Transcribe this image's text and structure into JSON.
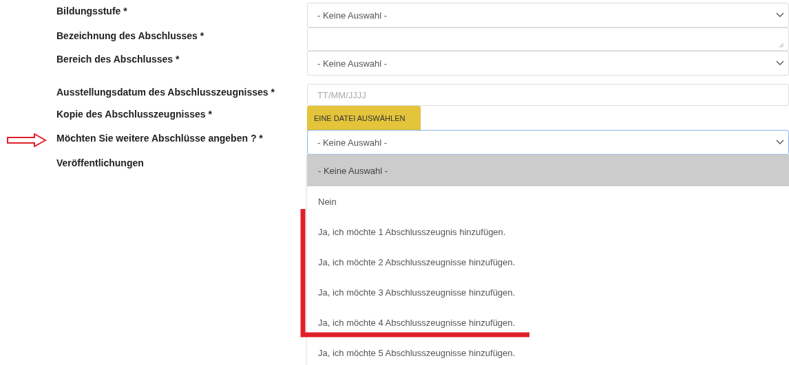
{
  "fields": [
    {
      "label": "Bildungsstufe *",
      "kind": "select",
      "value": "- Keine Auswahl -"
    },
    {
      "label": "Bezeichnung des Abschlusses *",
      "kind": "textarea"
    },
    {
      "label": "Bereich des Abschlusses *",
      "kind": "select",
      "value": "- Keine Auswahl -"
    },
    {
      "label": "Ausstellungsdatum des Abschlusszeugnisses *",
      "kind": "date",
      "placeholder": "TT/MM/JJJJ"
    },
    {
      "label": "Kopie des Abschlusszeugnisses *",
      "kind": "file",
      "button": "EINE DATEI AUSWÄHLEN"
    },
    {
      "label": "Möchten Sie weitere Abschlüsse angeben ? *",
      "kind": "select",
      "value": "- Keine Auswahl -",
      "expanded": true,
      "options": [
        {
          "label": "- Keine Auswahl -",
          "selected": true
        },
        {
          "label": "Nein",
          "selected": false
        },
        {
          "label": "Ja, ich möchte 1 Abschlusszeugnis hinzufügen.",
          "selected": false
        },
        {
          "label": "Ja, ich möchte 2 Abschlusszeugnisse hinzufügen.",
          "selected": false
        },
        {
          "label": "Ja, ich möchte 3 Abschlusszeugnisse hinzufügen.",
          "selected": false
        },
        {
          "label": "Ja, ich möchte 4 Abschlusszeugnisse hinzufügen.",
          "selected": false
        },
        {
          "label": "Ja, ich möchte 5 Abschlusszeugnisse hinzufügen.",
          "selected": false
        }
      ]
    },
    {
      "label": "Veröffentlichungen",
      "kind": "section"
    }
  ]
}
